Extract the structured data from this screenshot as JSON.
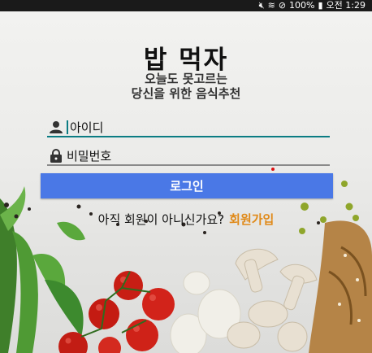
{
  "status_bar": {
    "battery": "100%",
    "time": "오전 1:29"
  },
  "app": {
    "title": "밥 먹자",
    "subtitle_line1": "오늘도 못고르는",
    "subtitle_line2": "당신을 위한 음식추천"
  },
  "login": {
    "id_value": "아이디",
    "password_value": "비밀번호",
    "button_label": "로그인"
  },
  "signup": {
    "prompt": "아직 회원이 아니신가요?",
    "link": "회원가입"
  },
  "colors": {
    "button": "#4a78e6",
    "link": "#e08a1a",
    "accent_underline": "#0b7c83"
  }
}
